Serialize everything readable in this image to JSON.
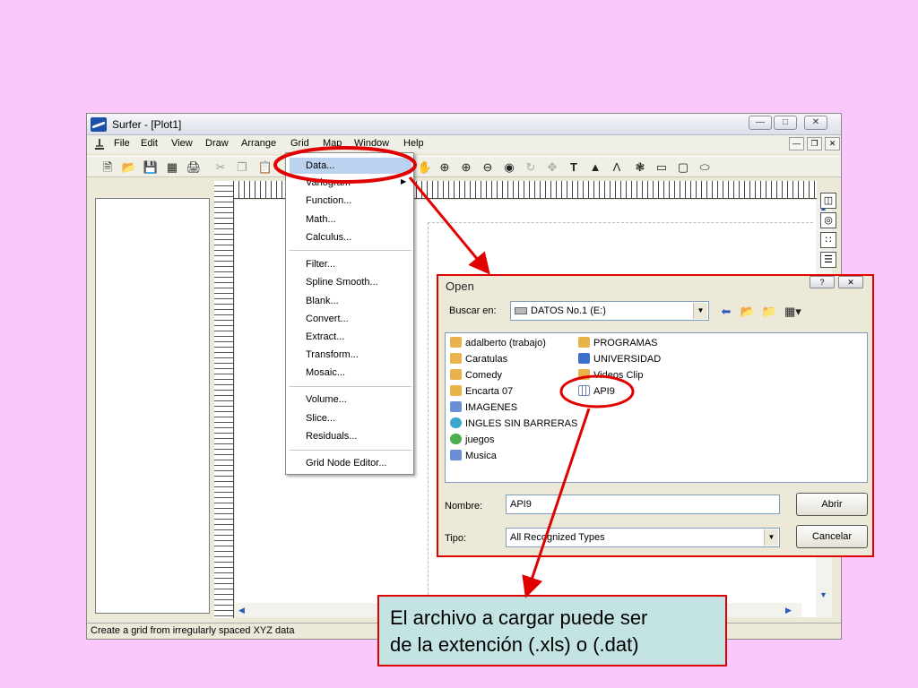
{
  "window": {
    "title": "Surfer - [Plot1]",
    "minimize_label": "—",
    "maximize_label": "□",
    "close_label": "✕"
  },
  "menubar": {
    "items": [
      "File",
      "Edit",
      "View",
      "Draw",
      "Arrange",
      "Grid",
      "Map",
      "Window",
      "Help"
    ]
  },
  "grid_menu": {
    "items": [
      "Data...",
      "Variogram",
      "Function...",
      "Math...",
      "Calculus...",
      "Filter...",
      "Spline Smooth...",
      "Blank...",
      "Convert...",
      "Extract...",
      "Transform...",
      "Mosaic...",
      "Volume...",
      "Slice...",
      "Residuals...",
      "Grid Node Editor..."
    ],
    "highlighted": "Data..."
  },
  "status_bar": {
    "text": "Create a grid from irregularly spaced XYZ data"
  },
  "open_dialog": {
    "title": "Open",
    "look_in_label": "Buscar en:",
    "look_in_value": "DATOS No.1 (E:)",
    "files_col1": [
      "adalberto (trabajo)",
      "Caratulas",
      "Comedy",
      "Encarta 07",
      "IMAGENES",
      "INGLES SIN BARRERAS",
      "juegos",
      "Musica"
    ],
    "files_col2": [
      "PROGRAMAS",
      "UNIVERSIDAD",
      "Videos Clip",
      "API9"
    ],
    "filename_label": "Nombre:",
    "filename_value": "API9",
    "filetype_label": "Tipo:",
    "filetype_value": "All Recognized Types",
    "open_button": "Abrir",
    "cancel_button": "Cancelar"
  },
  "callout": {
    "line1": "El archivo a cargar puede ser",
    "line2": "de la extención (.xls) o (.dat)"
  },
  "colors": {
    "slide_background": "#fbc8fb",
    "highlight_red": "#e00000",
    "callout_background": "#c4e3e3",
    "menu_highlight": "#bcd3f0"
  }
}
